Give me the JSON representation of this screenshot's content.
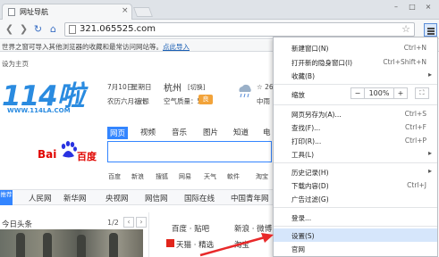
{
  "browser": {
    "tab_title": "网址导航",
    "tab_close": "×",
    "url": "321.065525.com",
    "window_controls": [
      "–",
      "□",
      "×"
    ],
    "nav_icons": [
      "back-icon",
      "forward-icon",
      "reload-icon",
      "home-icon"
    ]
  },
  "notice": {
    "text": "世界之窗可导入其他浏览器的收藏和最常访问网站等。",
    "link": "点此导入"
  },
  "page": {
    "set_home": "设为主页",
    "logo_text": "114啦",
    "logo_url": "WWW.114LA.COM",
    "date": "7月10日",
    "weekday": "星期日",
    "lunar": "农历六月初七",
    "yiji": "宜忌",
    "city": "杭州",
    "switch": "[切换]",
    "air_label": "空气质量：52",
    "air_badge": "良",
    "temp": "☆ 26°",
    "temp_sub": "中雨",
    "search_tabs": [
      "网页",
      "视频",
      "音乐",
      "图片",
      "知道",
      "电"
    ],
    "baidu_left": "Bai",
    "baidu_right": "百度",
    "search_links": [
      "百度",
      "新浪",
      "搜狐",
      "网易",
      "天气",
      "軟件",
      "淘宝"
    ],
    "nav_badge": "推荐",
    "nav_links": [
      "人民网",
      "新华网",
      "央视网",
      "网信网",
      "国际在线",
      "中国青年网"
    ],
    "today_label": "今日头条",
    "pager": "1/2",
    "pager_prev": "‹",
    "pager_next": "›",
    "right_links_row1": [
      "百度 · 贴吧",
      "新浪 · 微博"
    ],
    "right_links_row2": [
      "天猫 · 精选",
      "淘宝"
    ]
  },
  "menu": {
    "items": [
      {
        "label": "新建窗口(N)",
        "shortcut": "Ctrl+N",
        "submenu": false
      },
      {
        "label": "打开新的隐身窗口(I)",
        "shortcut": "Ctrl+Shift+N",
        "submenu": false
      },
      {
        "label": "收藏(B)",
        "shortcut": "",
        "submenu": true
      },
      {
        "label": "网页另存为(A)...",
        "shortcut": "Ctrl+S",
        "submenu": false
      },
      {
        "label": "查找(F)...",
        "shortcut": "Ctrl+F",
        "submenu": false
      },
      {
        "label": "打印(R)...",
        "shortcut": "Ctrl+P",
        "submenu": false
      },
      {
        "label": "工具(L)",
        "shortcut": "",
        "submenu": true
      },
      {
        "label": "历史记录(H)",
        "shortcut": "",
        "submenu": true
      },
      {
        "label": "下载内容(D)",
        "shortcut": "Ctrl+J",
        "submenu": false
      },
      {
        "label": "广告过滤(G)",
        "shortcut": "",
        "submenu": false
      },
      {
        "label": "登录...",
        "shortcut": "",
        "submenu": false
      },
      {
        "label": "设置(S)",
        "shortcut": "",
        "submenu": false
      },
      {
        "label": "官网",
        "shortcut": "",
        "submenu": false
      }
    ],
    "zoom_label": "缩放",
    "zoom_minus": "−",
    "zoom_value": "100%",
    "zoom_plus": "+",
    "highlight_color": "#d6e6fb",
    "arrow_color": "#e8292a"
  }
}
